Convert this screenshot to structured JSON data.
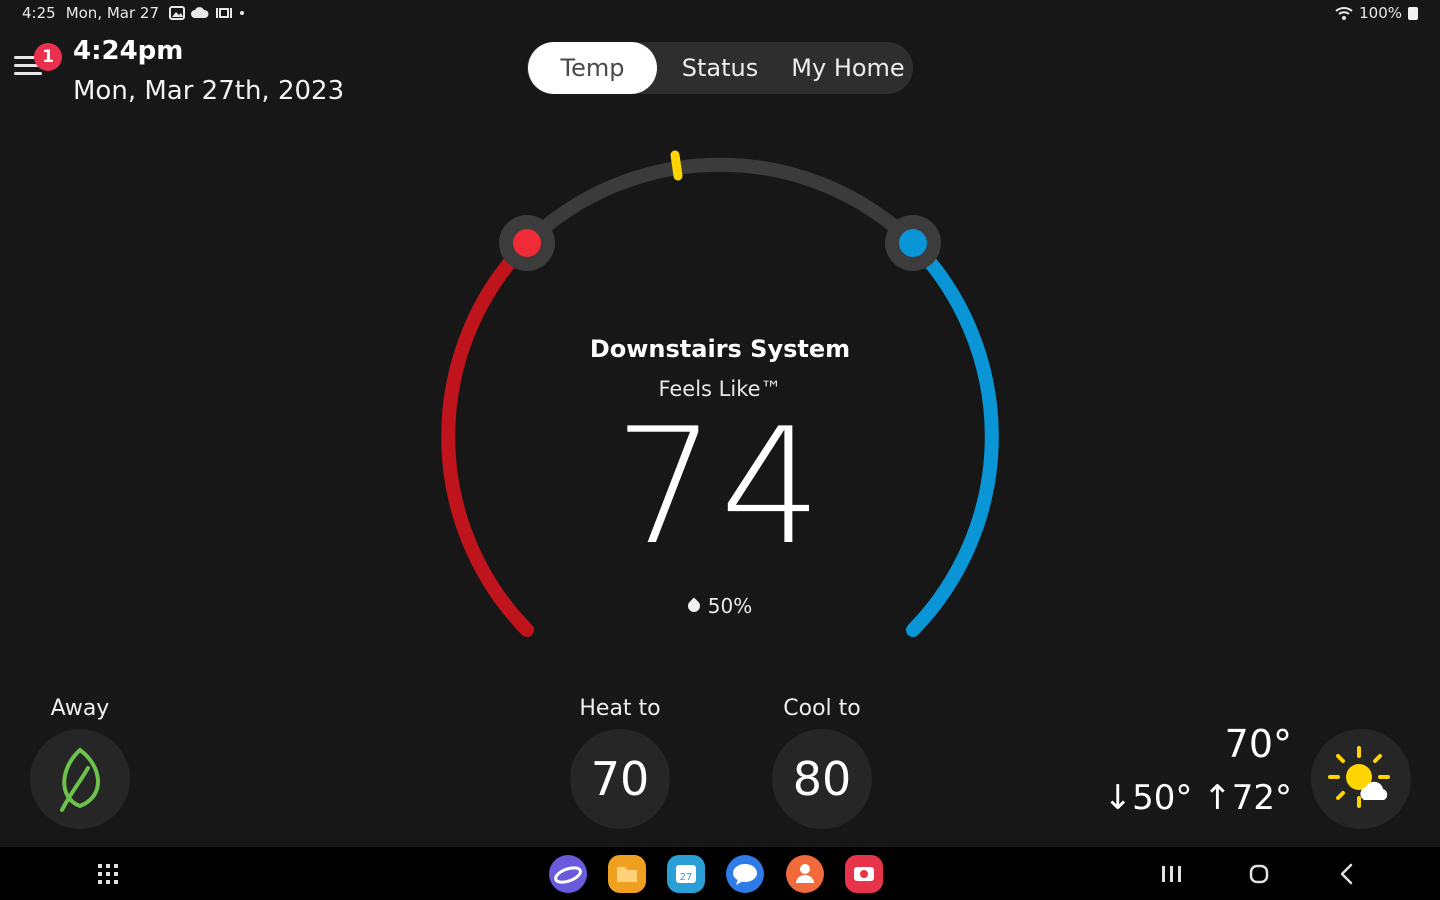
{
  "status_bar": {
    "time": "4:25",
    "date": "Mon, Mar 27",
    "battery": "100%"
  },
  "header": {
    "notification_count": "1",
    "clock": "4:24pm",
    "date": "Mon, Mar 27th, 2023"
  },
  "tabs": [
    {
      "label": "Temp",
      "active": true
    },
    {
      "label": "Status",
      "active": false
    },
    {
      "label": "My Home",
      "active": false
    }
  ],
  "thermostat": {
    "system_name": "Downstairs System",
    "feels_like_label": "Feels Like™",
    "current_temp": "74",
    "humidity": "50%",
    "heat_color": "#c0141c",
    "cool_color": "#0a95d6",
    "indicator_color": "#ffd400"
  },
  "controls": {
    "away_label": "Away",
    "heat_label": "Heat to",
    "heat_setpoint": "70",
    "cool_label": "Cool to",
    "cool_setpoint": "80"
  },
  "weather": {
    "current": "70°",
    "low": "↓50°",
    "high": "↑72°",
    "icon": "partly-sunny-icon"
  },
  "nav_apps": [
    {
      "name": "internet-app-icon",
      "color": "#6a5bdc"
    },
    {
      "name": "files-app-icon",
      "color": "#f0a020"
    },
    {
      "name": "calendar-app-icon",
      "color": "#2a9fd6"
    },
    {
      "name": "messages-app-icon",
      "color": "#2f7be8"
    },
    {
      "name": "contacts-app-icon",
      "color": "#f06a3b"
    },
    {
      "name": "screen-recorder-app-icon",
      "color": "#e8344a"
    }
  ],
  "calendar_day": "27"
}
